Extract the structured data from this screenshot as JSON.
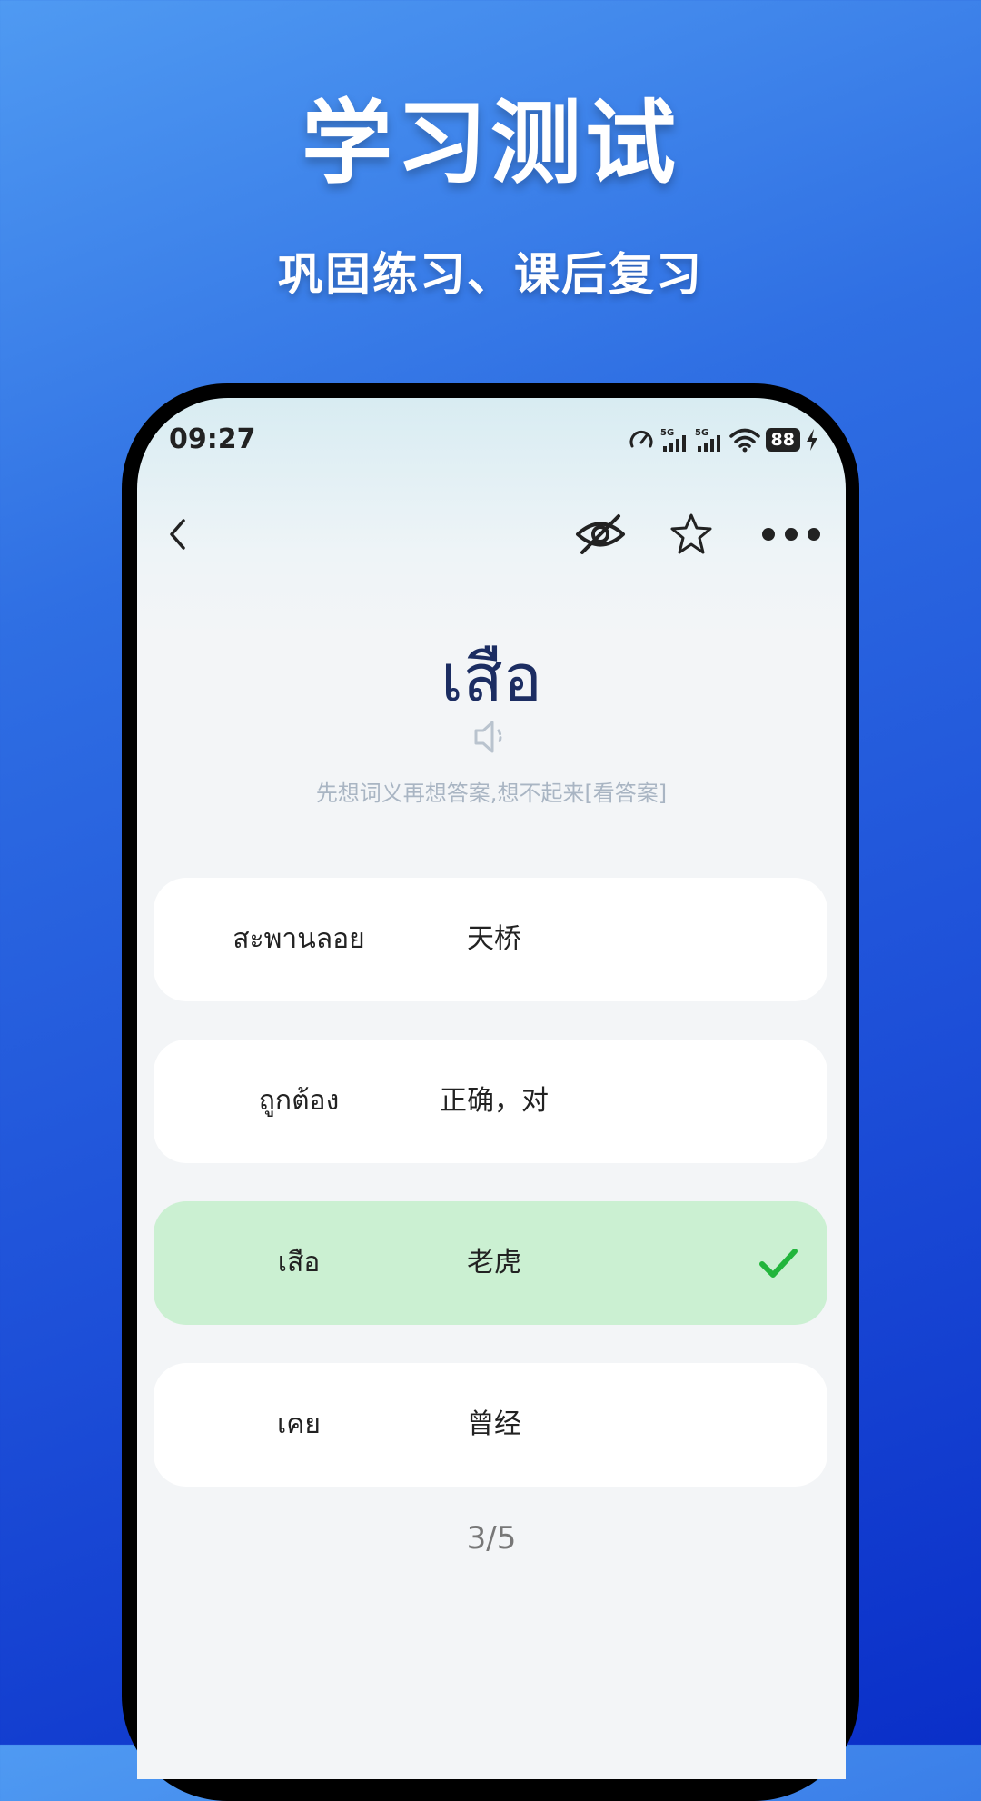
{
  "hero": {
    "title": "学习测试",
    "subtitle": "巩固练习、课后复习"
  },
  "status_bar": {
    "time": "09:27",
    "battery": "88",
    "network_labels": [
      "5G",
      "5G"
    ]
  },
  "question": {
    "word": "เสือ",
    "hint": "先想词义再想答案,想不起来[看答案]"
  },
  "options": [
    {
      "thai": "สะพานลอย",
      "chinese": "天桥",
      "state": "normal"
    },
    {
      "thai": "ถูกต้อง",
      "chinese": "正确，对",
      "state": "normal"
    },
    {
      "thai": "เสือ",
      "chinese": "老虎",
      "state": "correct"
    },
    {
      "thai": "เคย",
      "chinese": "曾经",
      "state": "normal"
    }
  ],
  "progress": "3/5",
  "colors": {
    "correct_bg": "#cbf0d2",
    "check_green": "#22b53c",
    "word_color": "#1c2d62"
  }
}
